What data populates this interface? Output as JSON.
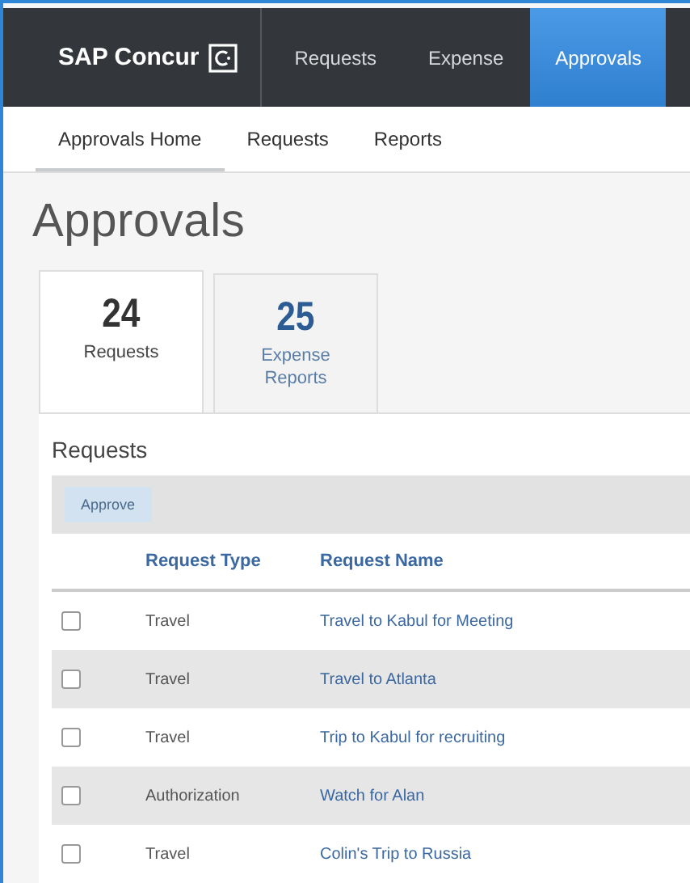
{
  "brand": {
    "name": "SAP Concur"
  },
  "nav": [
    {
      "label": "Requests",
      "selected": false
    },
    {
      "label": "Expense",
      "selected": false
    },
    {
      "label": "Approvals",
      "selected": true
    }
  ],
  "subnav": [
    {
      "label": "Approvals Home",
      "selected": true
    },
    {
      "label": "Requests",
      "selected": false
    },
    {
      "label": "Reports",
      "selected": false
    }
  ],
  "page_title": "Approvals",
  "tabs": [
    {
      "count": "24",
      "label": "Requests",
      "selected": true
    },
    {
      "count": "25",
      "label": "Expense Reports",
      "selected": false
    }
  ],
  "section_title": "Requests",
  "toolbar": {
    "approve_button": {
      "label": "Approve",
      "disabled": true
    }
  },
  "table": {
    "columns": [
      "Request Type",
      "Request Name"
    ],
    "rows": [
      {
        "checked": false,
        "type": "Travel",
        "name": "Travel to Kabul for Meeting"
      },
      {
        "checked": false,
        "type": "Travel",
        "name": "Travel to Atlanta"
      },
      {
        "checked": false,
        "type": "Travel",
        "name": "Trip to Kabul for recruiting"
      },
      {
        "checked": false,
        "type": "Authorization",
        "name": "Watch for Alan"
      },
      {
        "checked": false,
        "type": "Travel",
        "name": "Colin's Trip to Russia"
      }
    ]
  }
}
